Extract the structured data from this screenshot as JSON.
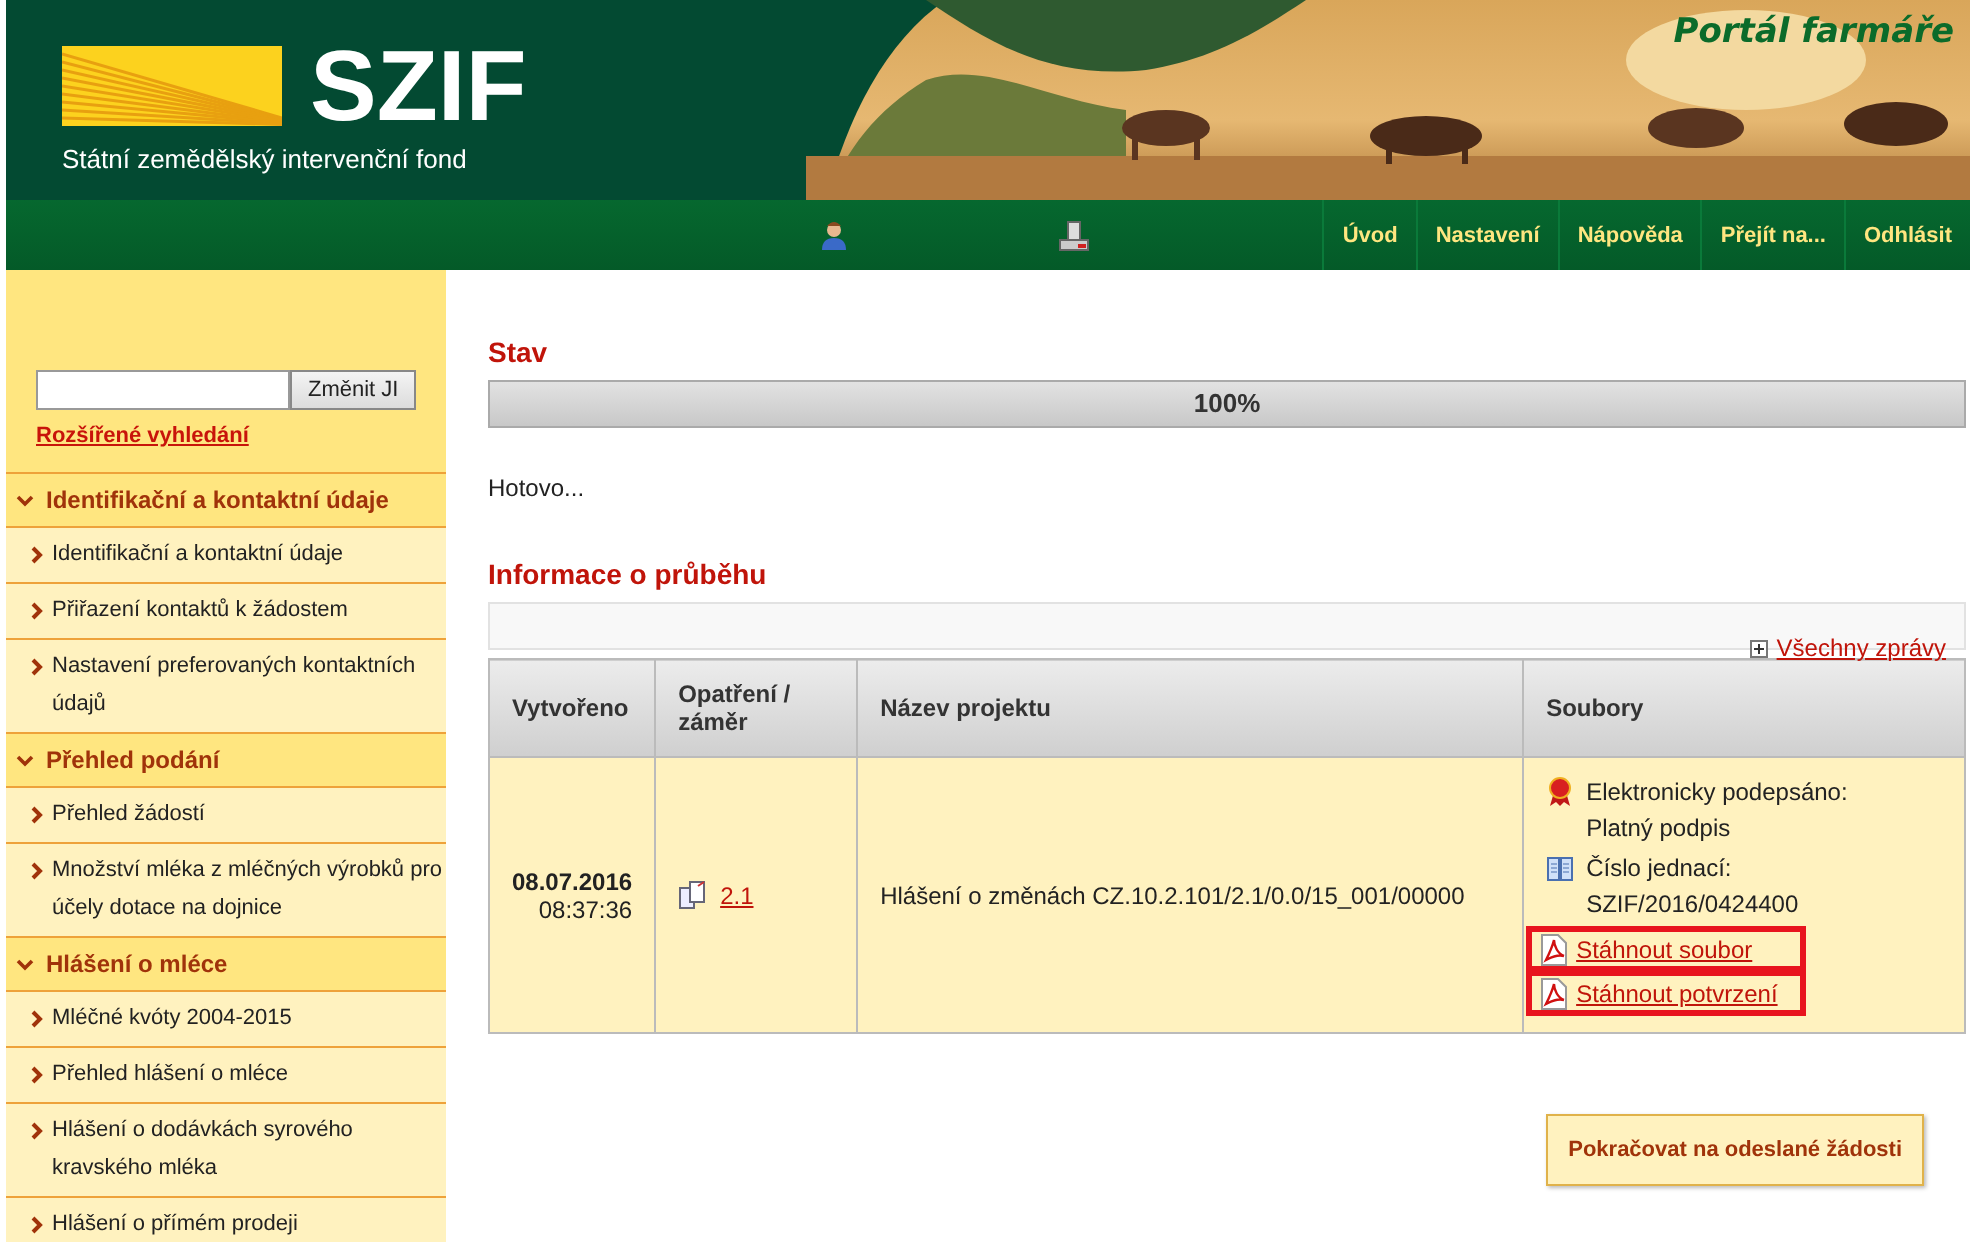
{
  "header": {
    "logo_text": "SZIF",
    "logo_subtitle": "Státní zemědělský intervenční fond",
    "portal_title": "Portál farmáře"
  },
  "nav": {
    "items": [
      {
        "label": "Úvod"
      },
      {
        "label": "Nastavení"
      },
      {
        "label": "Nápověda"
      },
      {
        "label": "Přejít na..."
      },
      {
        "label": "Odhlásit"
      }
    ]
  },
  "sidebar": {
    "search_button": "Změnit JI",
    "advanced_link": "Rozšířené vyhledání",
    "sections": [
      {
        "title": "Identifikační a kontaktní údaje",
        "expanded": true,
        "items": [
          "Identifikační a kontaktní údaje",
          "Přiřazení kontaktů k žádostem",
          "Nastavení preferovaných kontaktních údajů"
        ]
      },
      {
        "title": "Přehled podání",
        "expanded": true,
        "items": [
          "Přehled žádostí",
          "Množství mléka z mléčných výrobků pro účely dotace na dojnice"
        ]
      },
      {
        "title": "Hlášení o mléce",
        "expanded": true,
        "items": [
          "Mléčné kvóty 2004-2015",
          "Přehled hlášení o mléce",
          "Hlášení o dodávkách syrového kravského mléka",
          "Hlášení o přímém prodeji"
        ]
      }
    ]
  },
  "status": {
    "heading": "Stav",
    "progress": {
      "level": 1,
      "label": "100%"
    },
    "message": "Hotovo..."
  },
  "progress_info": {
    "heading": "Informace o průběhu",
    "all_messages_link": "Všechny zprávy"
  },
  "table": {
    "columns": [
      "Vytvořeno",
      "Opatření / záměr",
      "Název projektu",
      "Soubory"
    ],
    "rows": [
      {
        "date": "08.07.2016",
        "time": "08:37:36",
        "measure": "2.1",
        "project": "Hlášení o změnách CZ.10.2.101/2.1/0.0/15_001/00000",
        "files": [
          {
            "kind": "signature",
            "lines": [
              "Elektronicky podepsáno:",
              "Platný podpis"
            ]
          },
          {
            "kind": "reference",
            "lines": [
              "Číslo jednací:",
              "SZIF/2016/0424400"
            ]
          },
          {
            "kind": "download",
            "text": "Stáhnout soubor",
            "highlighted": true
          },
          {
            "kind": "download",
            "text": "Stáhnout potvrzení",
            "highlighted": true
          }
        ]
      }
    ]
  },
  "continue_button": "Pokračovat na odeslané žádosti"
}
